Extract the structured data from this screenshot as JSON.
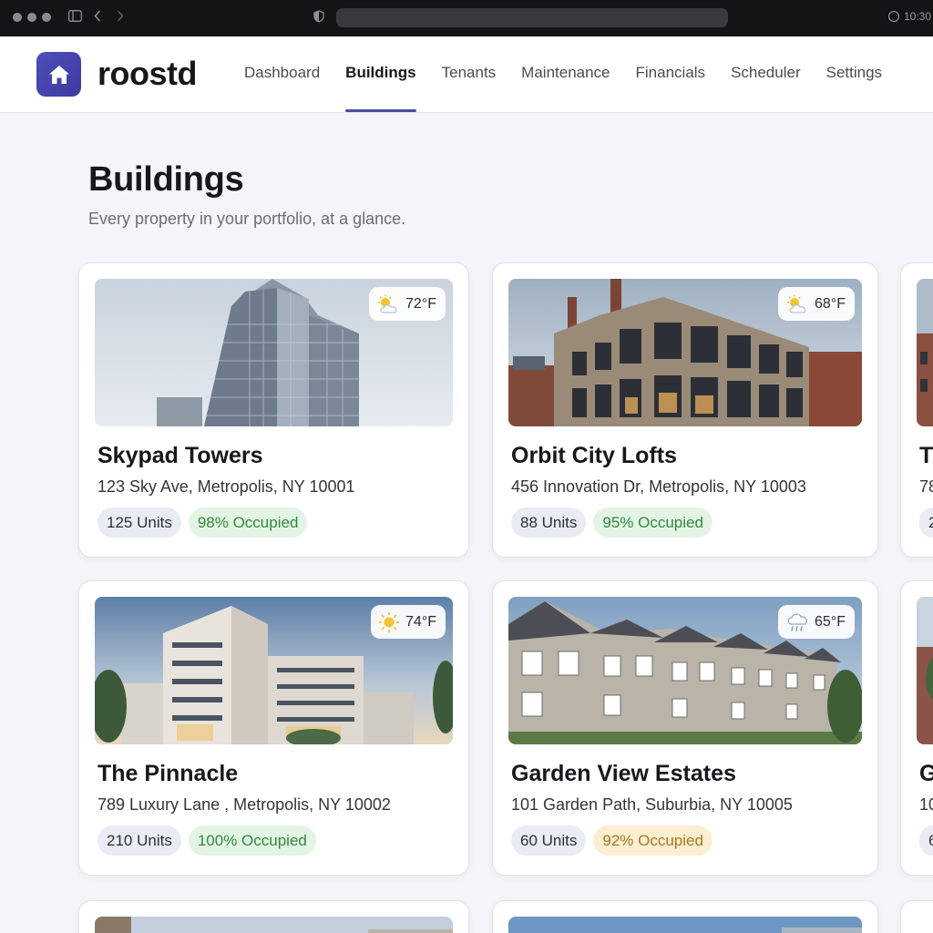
{
  "browser": {
    "time": "10:30"
  },
  "app": {
    "name": "roostd"
  },
  "nav": [
    {
      "label": "Dashboard",
      "active": false
    },
    {
      "label": "Buildings",
      "active": true
    },
    {
      "label": "Tenants",
      "active": false
    },
    {
      "label": "Maintenance",
      "active": false
    },
    {
      "label": "Financials",
      "active": false
    },
    {
      "label": "Scheduler",
      "active": false
    },
    {
      "label": "Settings",
      "active": false
    }
  ],
  "page": {
    "title": "Buildings",
    "subtitle": "Every property in your portfolio, at a glance."
  },
  "buildings": [
    {
      "name": "Skypad Towers",
      "address": "123 Sky Ave, Metropolis, NY 10001",
      "units": "125 Units",
      "occupancy": "98% Occupied",
      "occupancy_status": "green",
      "temperature": "72°F",
      "weather_icon": "partly-sunny-icon"
    },
    {
      "name": "Orbit City Lofts",
      "address": "456 Innovation Dr, Metropolis, NY 10003",
      "units": "88 Units",
      "occupancy": "95% Occupied",
      "occupancy_status": "green",
      "temperature": "68°F",
      "weather_icon": "partly-sunny-icon"
    },
    {
      "name": "T",
      "address": "78",
      "units": "2",
      "occupancy": "",
      "occupancy_status": "green",
      "temperature": "",
      "weather_icon": ""
    },
    {
      "name": "The Pinnacle",
      "address": "789 Luxury Lane , Metropolis, NY 10002",
      "units": "210 Units",
      "occupancy": "100% Occupied",
      "occupancy_status": "green",
      "temperature": "74°F",
      "weather_icon": "sun-icon"
    },
    {
      "name": "Garden View Estates",
      "address": "101 Garden Path, Suburbia, NY 10005",
      "units": "60 Units",
      "occupancy": "92% Occupied",
      "occupancy_status": "yellow",
      "temperature": "65°F",
      "weather_icon": "rain-cloud-icon"
    },
    {
      "name": "G",
      "address": "10",
      "units": "6",
      "occupancy": "",
      "occupancy_status": "green",
      "temperature": "",
      "weather_icon": ""
    }
  ],
  "colors": {
    "brand": "#4b4aa8",
    "occupied_green_bg": "#e3f4e4",
    "occupied_green_text": "#2f8a3e",
    "occupied_yellow_bg": "#fbefd2",
    "occupied_yellow_text": "#a7771a",
    "units_badge_bg": "#e9ebf5"
  }
}
